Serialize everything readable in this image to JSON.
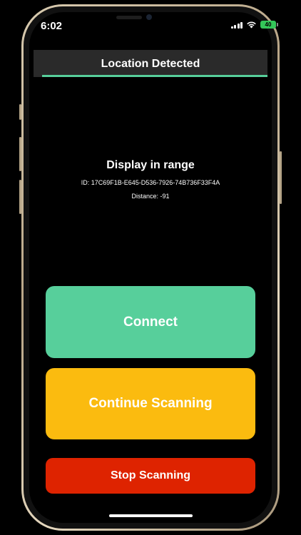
{
  "status_bar": {
    "time": "6:02",
    "battery": "40"
  },
  "header": {
    "title": "Location Detected"
  },
  "device_info": {
    "title": "Display in range",
    "id": "ID: 17C69F1B-E645-D536-7926-74B736F33F4A",
    "distance": "Distance: -91"
  },
  "actions": {
    "connect_label": "Connect",
    "continue_label": "Continue Scanning",
    "stop_label": "Stop Scanning"
  },
  "colors": {
    "accent_green": "#57cf9b",
    "accent_yellow": "#fbbb0f",
    "accent_red": "#de2300",
    "header_bg": "#2a2a2a",
    "battery_green": "#34c759"
  },
  "icons": {
    "signal": "cellular-signal-icon",
    "wifi": "wifi-icon",
    "battery": "battery-icon"
  }
}
